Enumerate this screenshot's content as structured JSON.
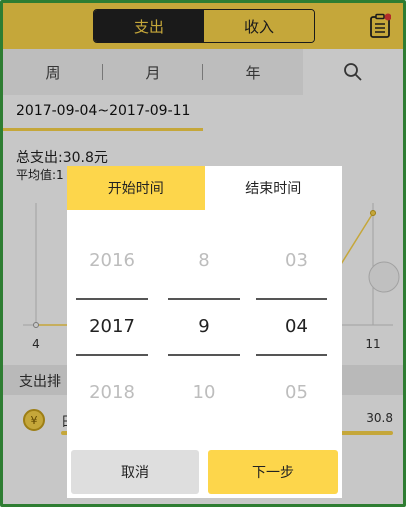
{
  "header": {
    "segments": [
      {
        "label": "支出",
        "active": true
      },
      {
        "label": "收入",
        "active": false
      }
    ],
    "right_icon": "document-icon",
    "accent_color": "#fdd64b"
  },
  "period_tabs": [
    "周",
    "月",
    "年"
  ],
  "search_icon": "search-icon",
  "date_range": "2017-09-04~2017-09-11",
  "summary": {
    "total": "总支出:30.8元",
    "average": "平均值:1"
  },
  "chart": {
    "x_labels": [
      "4",
      "11"
    ]
  },
  "ranking": {
    "title": "支出排",
    "rows": [
      {
        "icon": "yen-icon",
        "label": "日",
        "amount": "30.8"
      }
    ]
  },
  "dialog": {
    "tabs": [
      {
        "label": "开始时间",
        "active": true
      },
      {
        "label": "结束时间",
        "active": false
      }
    ],
    "year": {
      "above": "2016",
      "selected": "2017",
      "below": "2018"
    },
    "month": {
      "above": "8",
      "selected": "9",
      "below": "10"
    },
    "day": {
      "above": "03",
      "selected": "04",
      "below": "05"
    },
    "cancel_label": "取消",
    "next_label": "下一步"
  }
}
